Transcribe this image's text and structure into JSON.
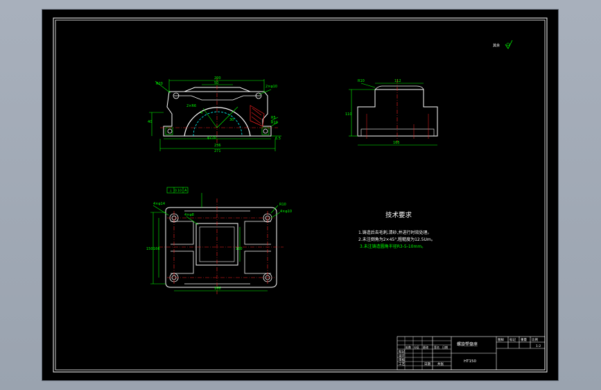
{
  "drawing": {
    "roughness_symbol": "其余",
    "front_view": {
      "dims": {
        "top_width": "200",
        "inner_top": "50",
        "radius_label": "R20",
        "hole_label": "2×φ10",
        "arc_label": "2×R6",
        "height_left": "40",
        "bore": "φ110",
        "base_width": "236",
        "overall_width": "271",
        "right_small_1": "R5",
        "right_small_2": "R10",
        "right_small_3": "6.5",
        "note_a": "4",
        "note_b": "30"
      }
    },
    "side_view": {
      "dims": {
        "top": "112",
        "left_top": "R10",
        "height": "110",
        "bottom": "165"
      }
    },
    "top_view": {
      "datum_box": [
        "⊥",
        "0.10",
        "A"
      ],
      "dims": {
        "corner_left": "4×φ14",
        "corner_right": "R10",
        "hole_right": "4×φ10",
        "inner_hole": "4×φ8",
        "left_h1": "150",
        "left_h2": "166",
        "inner_h": "100",
        "bottom_w": "166"
      }
    },
    "notes": {
      "title": "技术要求",
      "lines": [
        "1.铸造后去毛刺,清砂,并进行时效处理。",
        "2.未注倒角为2×45°,粗糙度为12.5Um。",
        "3.未注铸造圆角半径R3-5-10mm。"
      ]
    },
    "title_block": {
      "part_name": "螺旋塑盘座",
      "code": "HT150",
      "cols": [
        "图样",
        "标记",
        "重量",
        "比例"
      ],
      "scale": "1:2",
      "rows": [
        "标记",
        "设计",
        "审核",
        "工艺"
      ],
      "sig_labels": [
        "处数",
        "分区",
        "更改",
        "签名",
        "日期"
      ],
      "bottom_labels": [
        "日期",
        "共张"
      ]
    }
  }
}
